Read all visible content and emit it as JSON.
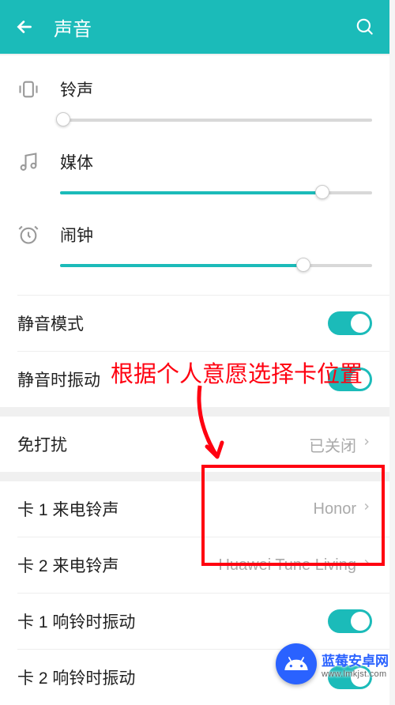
{
  "header": {
    "title": "声音"
  },
  "volumes": {
    "ringtone": {
      "label": "铃声",
      "percent": 1
    },
    "media": {
      "label": "媒体",
      "percent": 84
    },
    "alarm": {
      "label": "闹钟",
      "percent": 78
    }
  },
  "settings": {
    "silent_mode_label": "静音模式",
    "silent_mode_on": true,
    "vibrate_silent_label": "静音时振动",
    "vibrate_silent_on": true,
    "dnd_label": "免打扰",
    "dnd_value": "已关闭",
    "sim1_ringtone_label": "卡 1 来电铃声",
    "sim1_ringtone_value": "Honor",
    "sim2_ringtone_label": "卡 2 来电铃声",
    "sim2_ringtone_value": "Huawei Tune Living",
    "sim1_vibrate_label": "卡 1 响铃时振动",
    "sim1_vibrate_on": true,
    "sim2_vibrate_label": "卡 2 响铃时振动",
    "sim2_vibrate_on": true
  },
  "annotation": {
    "text": "根据个人意愿选择卡位置"
  },
  "watermark": {
    "title": "蓝莓安卓网",
    "url": "www.lmkjst.com"
  }
}
